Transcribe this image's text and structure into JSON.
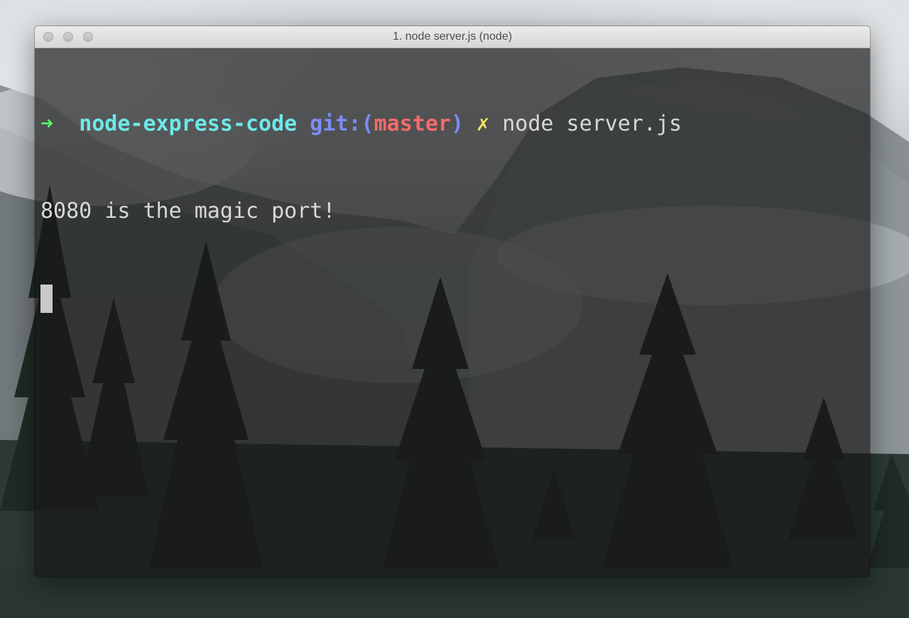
{
  "window": {
    "title": "1. node server.js (node)"
  },
  "terminal": {
    "prompt": {
      "arrow": "➜",
      "directory": "node-express-code",
      "git_prefix": "git:(",
      "branch": "master",
      "git_suffix": ")",
      "dirty_marker": "✗",
      "command": "node server.js"
    },
    "output": [
      "8080 is the magic port!"
    ]
  },
  "colors": {
    "arrow": "#5cf06a",
    "directory": "#6ee8e8",
    "git": "#7c8cf6",
    "branch": "#f56a6a",
    "dirty": "#f5e85c",
    "text": "#d8d8d8"
  }
}
